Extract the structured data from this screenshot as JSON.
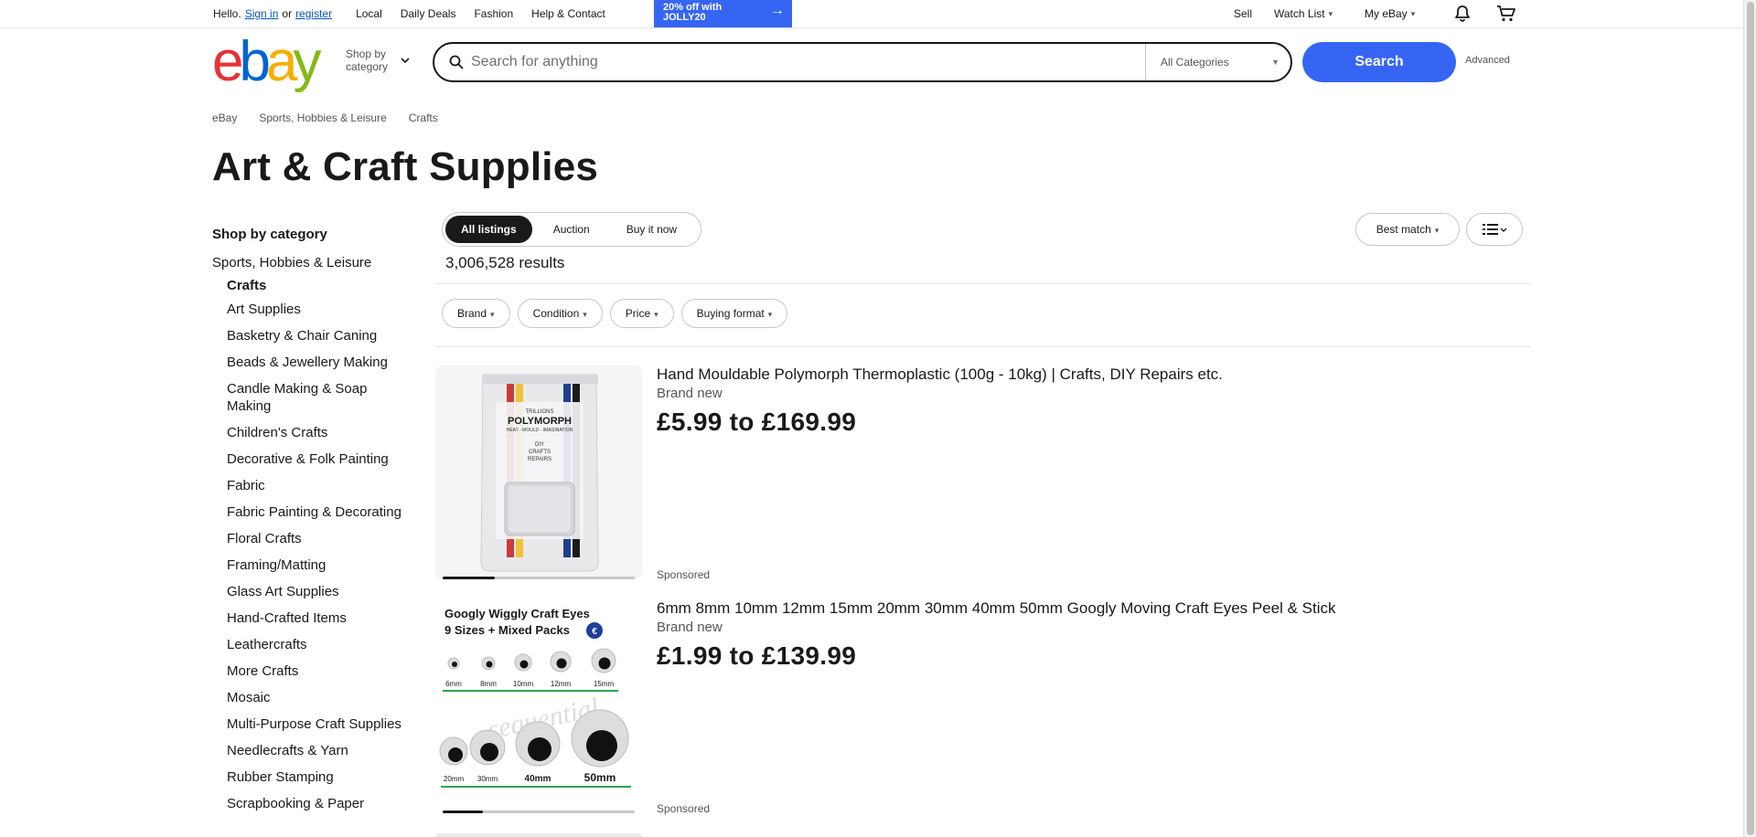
{
  "topnav": {
    "hello": "Hello.",
    "sign_in": "Sign in",
    "or": "or",
    "register": "register",
    "links": [
      "Local",
      "Daily Deals",
      "Fashion",
      "Help & Contact"
    ],
    "promo_line1": "20% off with",
    "promo_line2": "JOLLY20",
    "sell": "Sell",
    "watch_list": "Watch List",
    "my_ebay": "My eBay"
  },
  "header": {
    "shop_by_line1": "Shop by",
    "shop_by_line2": "category",
    "search_placeholder": "Search for anything",
    "category_select": "All Categories",
    "search_button": "Search",
    "advanced": "Advanced",
    "logo_colors": [
      "#e53238",
      "#0064d2",
      "#f5af02",
      "#86b817"
    ]
  },
  "breadcrumb": [
    "eBay",
    "Sports, Hobbies & Leisure",
    "Crafts"
  ],
  "page_title": "Art & Craft Supplies",
  "sidebar": {
    "heading": "Shop by category",
    "parent": "Sports, Hobbies & Leisure",
    "current": "Crafts",
    "items": [
      "Art Supplies",
      "Basketry & Chair Caning",
      "Beads & Jewellery Making",
      "Candle Making & Soap Making",
      "Children's Crafts",
      "Decorative & Folk Painting",
      "Fabric",
      "Fabric Painting & Decorating",
      "Floral Crafts",
      "Framing/Matting",
      "Glass Art Supplies",
      "Hand-Crafted Items",
      "Leathercrafts",
      "More Crafts",
      "Mosaic",
      "Multi-Purpose Craft Supplies",
      "Needlecrafts & Yarn",
      "Rubber Stamping",
      "Scrapbooking & Paper"
    ]
  },
  "tabs": [
    "All listings",
    "Auction",
    "Buy it now"
  ],
  "results": "3,006,528 results",
  "sort": "Best match",
  "filters": [
    "Brand",
    "Condition",
    "Price",
    "Buying format"
  ],
  "listings": [
    {
      "title": "Hand Mouldable Polymorph Thermoplastic (100g - 10kg) | Crafts, DIY Repairs etc.",
      "condition": "Brand new",
      "price": "£5.99 to £169.99",
      "sponsored": "Sponsored",
      "image_progress": 0.27,
      "image_text": {
        "brand": "TRILLIONS",
        "product": "POLYMORPH",
        "tagline": "HEAT - MOULD - IMAGINATION",
        "uses": [
          "DIY",
          "CRAFTS",
          "REPAIRS"
        ]
      }
    },
    {
      "title": "6mm 8mm 10mm 12mm 15mm 20mm 30mm 40mm 50mm Googly Moving Craft Eyes Peel & Stick",
      "condition": "Brand new",
      "price": "£1.99 to £139.99",
      "sponsored": "Sponsored",
      "image_progress": 0.21,
      "image_text": {
        "headline_line1": "Googly Wiggly Craft Eyes",
        "headline_line2": "9 Sizes + Mixed Packs",
        "sizes_top": [
          "6mm",
          "8mm",
          "10mm",
          "12mm",
          "15mm"
        ],
        "sizes_bottom": [
          "20mm",
          "30mm",
          "40mm",
          "50mm"
        ],
        "watermark": "sequential"
      }
    }
  ]
}
